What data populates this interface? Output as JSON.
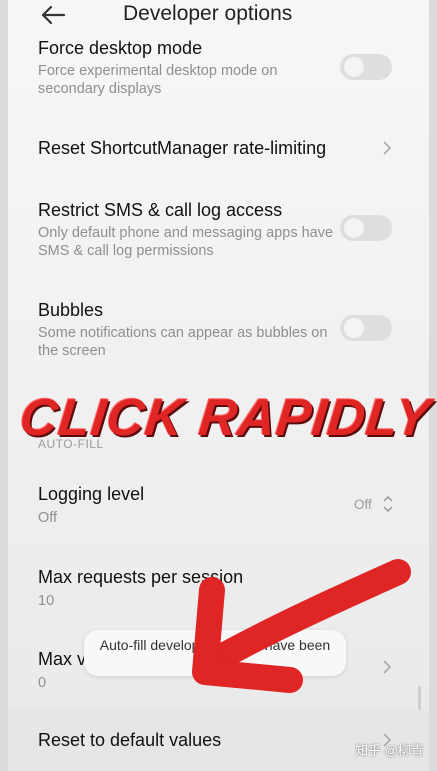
{
  "header": {
    "title": "Developer options",
    "back_icon": "arrow-left-icon"
  },
  "settings": [
    {
      "title": "Force desktop mode",
      "subtitle": "Force experimental desktop mode on secondary displays",
      "control": "toggle",
      "state": "off"
    },
    {
      "title": "Reset ShortcutManager rate-limiting",
      "control": "chevron"
    },
    {
      "title": "Restrict SMS & call log access",
      "subtitle": "Only default phone and messaging apps have SMS & call log permissions",
      "control": "toggle",
      "state": "off"
    },
    {
      "title": "Bubbles",
      "subtitle": "Some notifications can appear as bubbles on the screen",
      "control": "toggle",
      "state": "off"
    }
  ],
  "autofill": {
    "section_label": "AUTO-FILL",
    "logging_level": {
      "title": "Logging level",
      "subtitle": "Off",
      "value": "Off",
      "icon": "up-down-arrows-icon"
    },
    "max_requests": {
      "title": "Max requests per session",
      "subtitle": "10"
    },
    "max_visible": {
      "title": "Max v",
      "subtitle": "0",
      "control": "chevron"
    }
  },
  "reset_defaults": {
    "title": "Reset to default values",
    "control": "chevron"
  },
  "toast": {
    "text": "Auto-fill developer options have been reset"
  },
  "overlay": {
    "caption": "CLICK RAPIDLY",
    "arrow_color": "#e02525",
    "arrow_direction": "down-left"
  },
  "watermark": {
    "text": "知乎 @柳青"
  },
  "colors": {
    "accent_red": "#e02525",
    "toggle_off": "#dedede",
    "text_primary": "#111111",
    "text_secondary": "#8f8f8f"
  }
}
